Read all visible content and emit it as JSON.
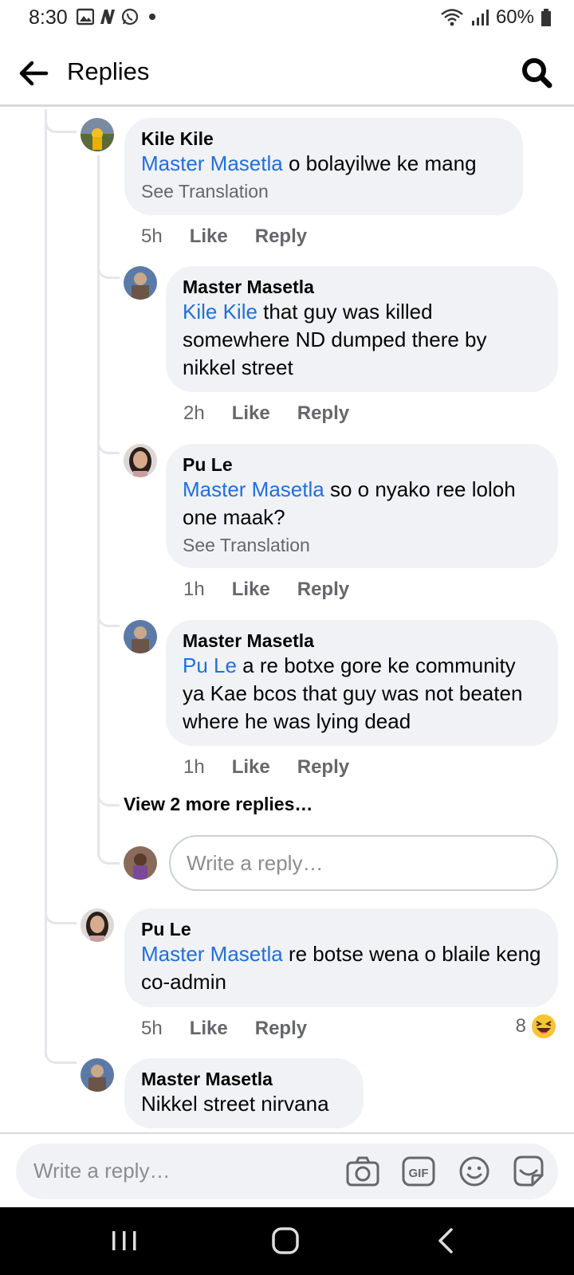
{
  "status_bar": {
    "time": "8:30",
    "battery": "60%"
  },
  "header": {
    "title": "Replies"
  },
  "comments": [
    {
      "name": "Kile Kile",
      "mention": "Master Masetla",
      "text": " o bolayilwe ke mang",
      "translation": "See Translation",
      "time": "5h",
      "like": "Like",
      "reply": "Reply"
    },
    {
      "name": "Master Masetla",
      "mention": "Kile Kile",
      "text": "  that guy was killed somewhere ND dumped there by nikkel street",
      "time": "2h",
      "like": "Like",
      "reply": "Reply"
    },
    {
      "name": "Pu Le",
      "mention": "Master Masetla",
      "text": " so o nyako ree loloh one maak?",
      "translation": "See Translation",
      "time": "1h",
      "like": "Like",
      "reply": "Reply"
    },
    {
      "name": "Master Masetla",
      "mention": "Pu Le",
      "text": " a re botxe gore ke community ya Kae bcos that guy was not beaten where he was lying dead",
      "time": "1h",
      "like": "Like",
      "reply": "Reply"
    },
    {
      "name": "Pu Le",
      "mention": "Master Masetla",
      "text": " re botse wena o blaile keng co-admin",
      "time": "5h",
      "like": "Like",
      "reply": "Reply",
      "reaction_count": "8"
    },
    {
      "name": "Master Masetla",
      "text": "Nikkel street nirvana"
    }
  ],
  "view_more": "View 2 more replies…",
  "nested_reply_placeholder": "Write a reply…",
  "composer": {
    "placeholder": "Write a reply…"
  },
  "icons": {
    "back": "arrow-left-icon",
    "search": "search-icon",
    "camera": "camera-icon",
    "gif": "gif-icon",
    "emoji": "smiley-icon",
    "sticker": "sticker-icon"
  },
  "colors": {
    "mention": "#216fdb",
    "bubble": "#f0f2f5",
    "secondary_text": "#65676b"
  }
}
